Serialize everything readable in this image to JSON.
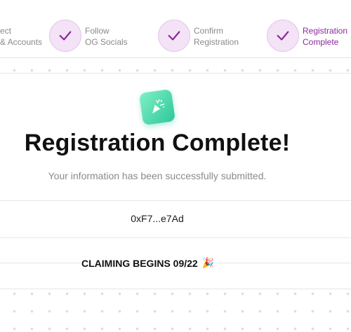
{
  "stepper": {
    "steps": [
      {
        "label_line1": "ect",
        "label_line2": "& Accounts",
        "state": "done"
      },
      {
        "label_line1": "Follow",
        "label_line2": "OG Socials",
        "state": "done"
      },
      {
        "label_line1": "Confirm",
        "label_line2": "Registration",
        "state": "done"
      },
      {
        "label_line1": "Registration",
        "label_line2": "Complete",
        "state": "active"
      }
    ],
    "check_icon": "checkmark-icon"
  },
  "confirmation": {
    "icon": "party-popper-icon",
    "title": "Registration Complete!",
    "subtitle": "Your information has been successfully submitted.",
    "wallet_address": "0xF7...e7Ad",
    "claim_text": "CLAIMING BEGINS 09/22",
    "claim_emoji": "🎉"
  },
  "colors": {
    "accent": "#8a2a9a",
    "step_bg": "#f4e3f7",
    "success_green": "#2ec79a",
    "muted_text": "#8a8a8a"
  }
}
